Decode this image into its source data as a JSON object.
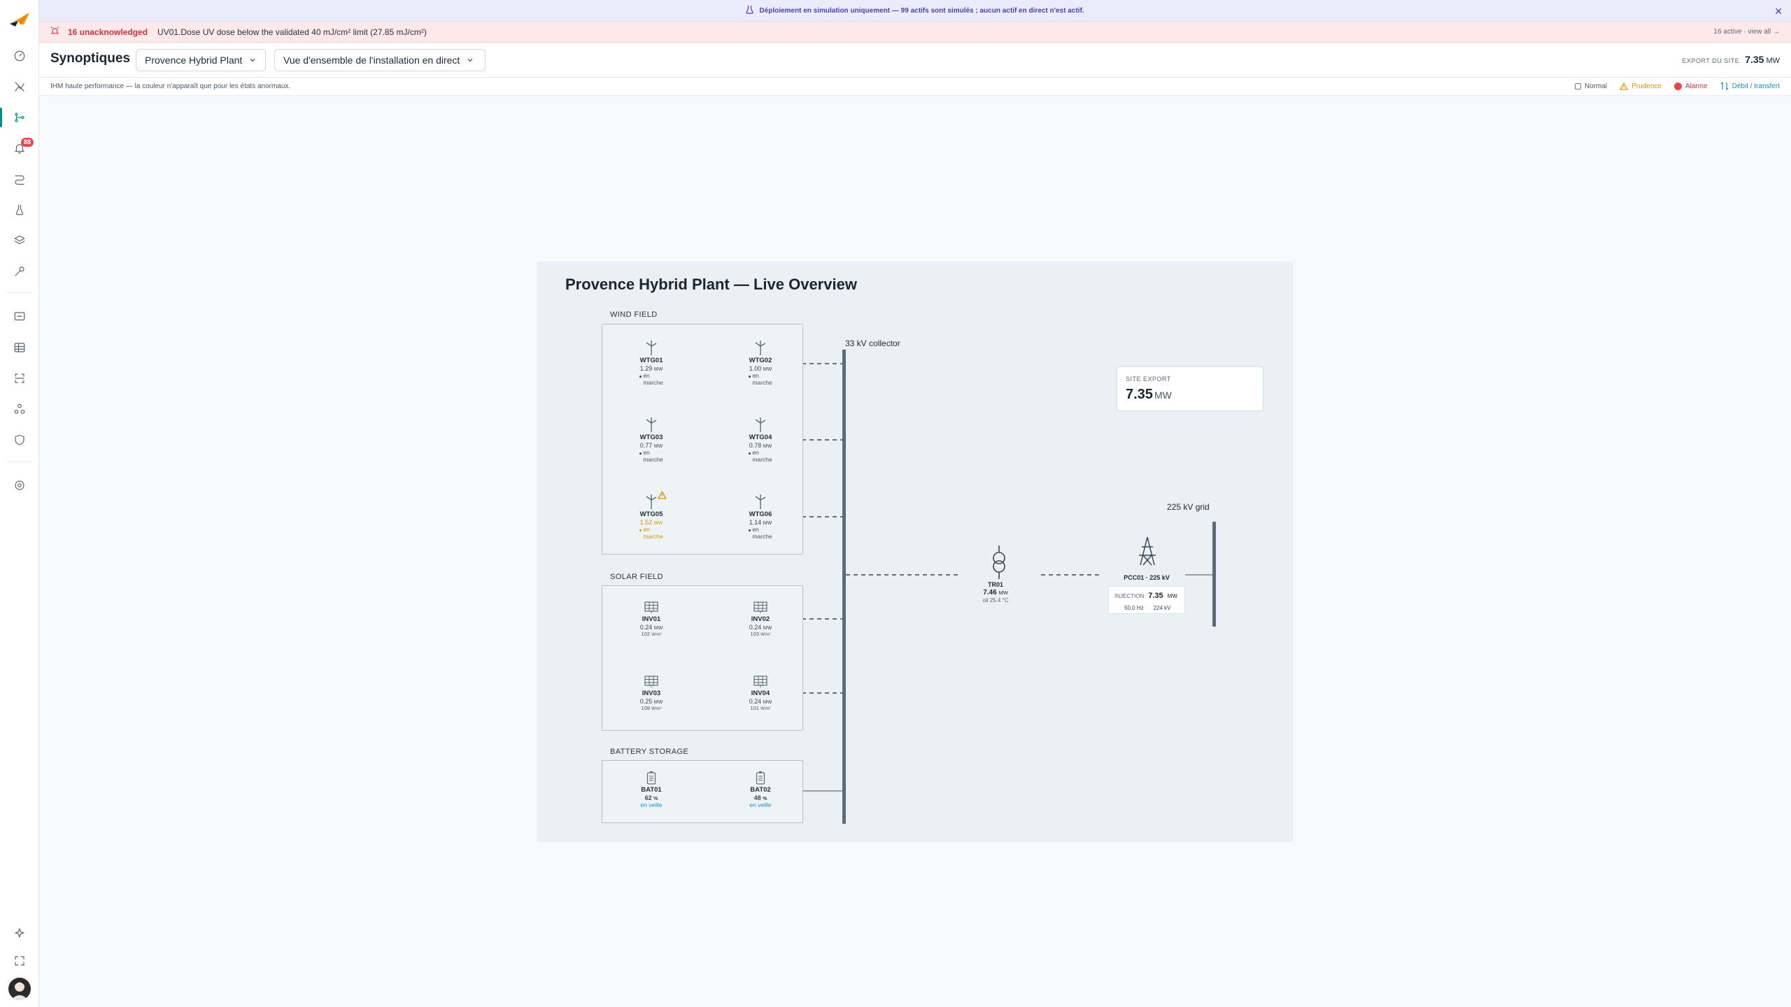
{
  "simulation_banner": {
    "text": "Déploiement en simulation uniquement — 99 actifs sont simulés ; aucun actif en direct n'est actif."
  },
  "alarm_bar": {
    "count": "16 unacknowledged",
    "message": "UV01.Dose UV dose below the validated 40 mJ/cm² limit (27.85 mJ/cm²)",
    "right": "16 active · view all →"
  },
  "sidebar": {
    "notification_badge": "88"
  },
  "header": {
    "title": "Synoptiques",
    "site_select": "Provence Hybrid Plant",
    "view_select": "Vue d'ensemble de l'installation en direct",
    "export_label": "EXPORT DU SITE",
    "export_value": "7.35",
    "export_unit": "MW"
  },
  "infobar": {
    "note": "IHM haute performance — la couleur n'apparaît que pour les états anormaux.",
    "legend": {
      "normal": "Normal",
      "caution": "Prudence",
      "alarm": "Alarme",
      "flow": "Débit / transfert"
    }
  },
  "colors": {
    "accent": "#0b8a7f",
    "alarm": "#e5484d",
    "caution": "#d9920b",
    "flow": "#1a8fc7",
    "sim": "#4a3fb3"
  },
  "diagram": {
    "title": "Provence Hybrid Plant — Live Overview",
    "collector_label": "33 kV collector",
    "grid_label": "225 kV grid",
    "wind_field": {
      "label": "WIND FIELD",
      "turbines": [
        {
          "name": "WTG01",
          "power": "1.29",
          "unit": "MW",
          "state_1": "en",
          "state_2": "marche",
          "status": "normal"
        },
        {
          "name": "WTG02",
          "power": "1.00",
          "unit": "MW",
          "state_1": "en",
          "state_2": "marche",
          "status": "normal"
        },
        {
          "name": "WTG03",
          "power": "0.77",
          "unit": "MW",
          "state_1": "en",
          "state_2": "marche",
          "status": "normal"
        },
        {
          "name": "WTG04",
          "power": "0.78",
          "unit": "MW",
          "state_1": "en",
          "state_2": "marche",
          "status": "normal"
        },
        {
          "name": "WTG05",
          "power": "1.52",
          "unit": "MW",
          "state_1": "en",
          "state_2": "marche",
          "status": "caution"
        },
        {
          "name": "WTG06",
          "power": "1.14",
          "unit": "MW",
          "state_1": "en",
          "state_2": "marche",
          "status": "normal"
        }
      ]
    },
    "solar_field": {
      "label": "SOLAR FIELD",
      "inverters": [
        {
          "name": "INV01",
          "power": "0.24",
          "unit": "MW",
          "irr": "102",
          "irr_unit": "W/m²"
        },
        {
          "name": "INV02",
          "power": "0.24",
          "unit": "MW",
          "irr": "103",
          "irr_unit": "W/m²"
        },
        {
          "name": "INV03",
          "power": "0.25",
          "unit": "MW",
          "irr": "108",
          "irr_unit": "W/m²"
        },
        {
          "name": "INV04",
          "power": "0.24",
          "unit": "MW",
          "irr": "101",
          "irr_unit": "W/m²"
        }
      ]
    },
    "battery_storage": {
      "label": "BATTERY STORAGE",
      "batteries": [
        {
          "name": "BAT01",
          "soc": "62",
          "unit": "%",
          "state": "en veille"
        },
        {
          "name": "BAT02",
          "soc": "48",
          "unit": "%",
          "state": "en veille"
        }
      ]
    },
    "transformer": {
      "name": "TR01",
      "power": "7.46",
      "unit": "MW",
      "oil": "oil 25.4 °C"
    },
    "pcc": {
      "name": "PCC01 · 225 kV",
      "injection_label": "INJECTION",
      "injection_value": "7.35",
      "injection_unit": "MW",
      "frequency": "50.0 Hz",
      "voltage": "224 kV"
    },
    "site_export": {
      "label": "SITE EXPORT",
      "value": "7.35",
      "unit": "MW"
    }
  }
}
